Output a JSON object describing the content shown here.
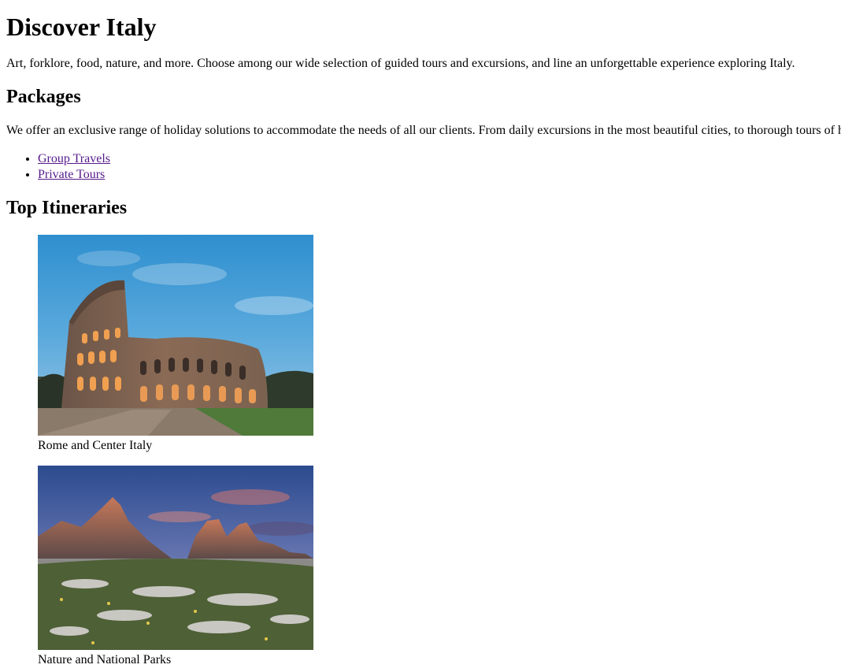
{
  "page": {
    "title": "Discover Italy",
    "intro": "Art, forklore, food, nature, and more. Choose among our wide selection of guided tours and excursions, and line an unforgettable experience exploring Italy."
  },
  "packages": {
    "heading": "Packages",
    "text": "We offer an exclusive range of holiday solutions to accommodate the needs of all our clients. From daily excursions in the most beautiful cities, to thorough tours of h",
    "links": [
      {
        "label": "Group Travels"
      },
      {
        "label": "Private Tours"
      }
    ]
  },
  "itineraries": {
    "heading": "Top Itineraries",
    "items": [
      {
        "caption": "Rome and Center Italy",
        "image": "colosseum-photo"
      },
      {
        "caption": "Nature and National Parks",
        "image": "dolomites-photo"
      }
    ]
  },
  "colors": {
    "link_visited": "#551a8b",
    "text": "#000000",
    "background": "#ffffff"
  }
}
